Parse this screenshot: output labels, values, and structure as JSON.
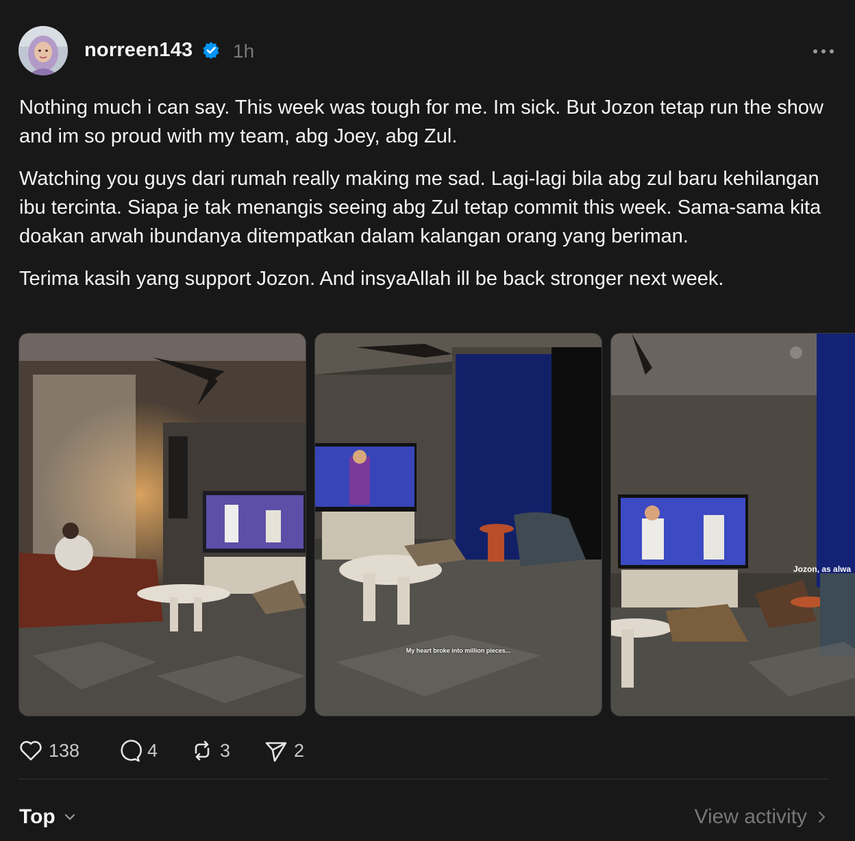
{
  "post": {
    "username": "norreen143",
    "time": "1h",
    "paragraphs": [
      "Nothing much i can say. This week was tough for me. Im sick. But Jozon tetap run the show and im so proud with my team, abg Joey, abg Zul.",
      "Watching you guys dari rumah really making me sad. Lagi-lagi bila abg zul baru kehilangan ibu tercinta. Siapa je tak menangis seeing abg Zul tetap commit this week. Sama-sama kita doakan arwah ibundanya ditempatkan dalam kalangan orang yang beriman.",
      "Terima kasih yang support Jozon. And insyaAllah ill be back stronger next week."
    ],
    "photos": [
      {
        "caption": ""
      },
      {
        "caption": "My heart broke into million pieces..."
      },
      {
        "caption": "Jozon, as alwa"
      }
    ],
    "stats": {
      "likes": "138",
      "comments": "4",
      "reposts": "3",
      "shares": "2"
    }
  },
  "footer": {
    "sort_label": "Top",
    "view_activity": "View activity"
  },
  "icons": {
    "verified": "verified-badge-icon",
    "more": "more-horizontal-icon",
    "like": "heart-icon",
    "comment": "comment-bubble-icon",
    "repost": "repost-icon",
    "share": "send-icon",
    "sort": "chevron-down-icon",
    "view": "chevron-right-icon"
  },
  "colors": {
    "background": "#181818",
    "text": "#f3f5f7",
    "muted": "#777777",
    "verified": "#0095f6"
  }
}
